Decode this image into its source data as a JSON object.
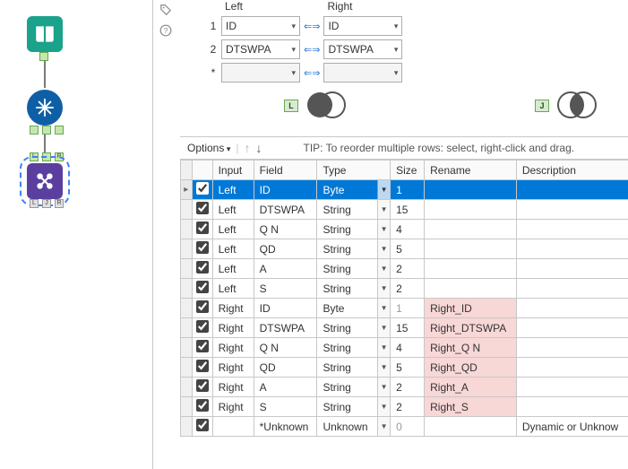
{
  "canvas": {
    "anchors": [
      "L",
      "J",
      "R"
    ]
  },
  "side_icons": [
    "tag-icon",
    "help-icon"
  ],
  "join_keys": {
    "headers": {
      "left": "Left",
      "right": "Right"
    },
    "rows": [
      {
        "num": "1",
        "left": "ID",
        "right": "ID"
      },
      {
        "num": "2",
        "left": "DTSWPA",
        "right": "DTSWPA"
      },
      {
        "num": "*",
        "left": "",
        "right": ""
      }
    ]
  },
  "venn": {
    "left_anchor": "L",
    "right_anchor": "J"
  },
  "options_bar": {
    "label": "Options",
    "tip": "TIP: To reorder multiple rows: select, right-click and drag."
  },
  "grid": {
    "headers": {
      "input": "Input",
      "field": "Field",
      "type": "Type",
      "size": "Size",
      "rename": "Rename",
      "description": "Description"
    },
    "rows": [
      {
        "checked": true,
        "input": "Left",
        "field": "ID",
        "type": "Byte",
        "size": "1",
        "rename": "",
        "desc": "",
        "selected": true
      },
      {
        "checked": true,
        "input": "Left",
        "field": "DTSWPA",
        "type": "String",
        "size": "15",
        "rename": "",
        "desc": ""
      },
      {
        "checked": true,
        "input": "Left",
        "field": "Q N",
        "type": "String",
        "size": "4",
        "rename": "",
        "desc": ""
      },
      {
        "checked": true,
        "input": "Left",
        "field": "QD",
        "type": "String",
        "size": "5",
        "rename": "",
        "desc": ""
      },
      {
        "checked": true,
        "input": "Left",
        "field": "A",
        "type": "String",
        "size": "2",
        "rename": "",
        "desc": ""
      },
      {
        "checked": true,
        "input": "Left",
        "field": "S",
        "type": "String",
        "size": "2",
        "rename": "",
        "desc": ""
      },
      {
        "checked": true,
        "input": "Right",
        "field": "ID",
        "type": "Byte",
        "size": "1",
        "rename": "Right_ID",
        "desc": "",
        "gray_size": true,
        "hl_rename": true
      },
      {
        "checked": true,
        "input": "Right",
        "field": "DTSWPA",
        "type": "String",
        "size": "15",
        "rename": "Right_DTSWPA",
        "desc": "",
        "hl_rename": true
      },
      {
        "checked": true,
        "input": "Right",
        "field": "Q N",
        "type": "String",
        "size": "4",
        "rename": "Right_Q N",
        "desc": "",
        "hl_rename": true
      },
      {
        "checked": true,
        "input": "Right",
        "field": "QD",
        "type": "String",
        "size": "5",
        "rename": "Right_QD",
        "desc": "",
        "hl_rename": true
      },
      {
        "checked": true,
        "input": "Right",
        "field": "A",
        "type": "String",
        "size": "2",
        "rename": "Right_A",
        "desc": "",
        "hl_rename": true
      },
      {
        "checked": true,
        "input": "Right",
        "field": "S",
        "type": "String",
        "size": "2",
        "rename": "Right_S",
        "desc": "",
        "hl_rename": true
      },
      {
        "checked": true,
        "input": "",
        "field": "*Unknown",
        "type": "Unknown",
        "size": "0",
        "rename": "",
        "desc": "Dynamic or Unknow",
        "gray_type": true,
        "gray_size": true
      }
    ]
  }
}
